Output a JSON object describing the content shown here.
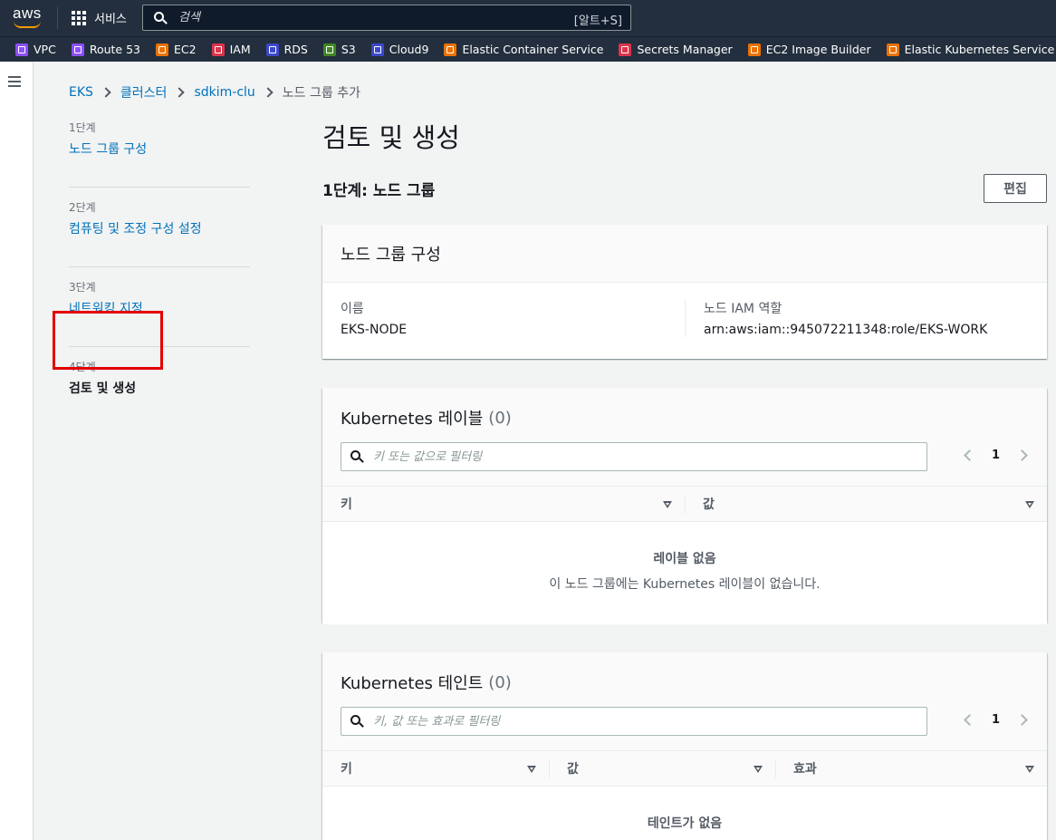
{
  "topnav": {
    "logo_text": "aws",
    "services_label": "서비스",
    "search_placeholder": "검색",
    "search_shortcut": "[알트+S]"
  },
  "favorites": [
    {
      "label": "VPC",
      "color": "#8c4fff"
    },
    {
      "label": "Route 53",
      "color": "#8c4fff"
    },
    {
      "label": "EC2",
      "color": "#ed7100"
    },
    {
      "label": "IAM",
      "color": "#dd344c"
    },
    {
      "label": "RDS",
      "color": "#3b48cc"
    },
    {
      "label": "S3",
      "color": "#3f8624"
    },
    {
      "label": "Cloud9",
      "color": "#3b48cc"
    },
    {
      "label": "Elastic Container Service",
      "color": "#ed7100"
    },
    {
      "label": "Secrets Manager",
      "color": "#dd344c"
    },
    {
      "label": "EC2 Image Builder",
      "color": "#ed7100"
    },
    {
      "label": "Elastic Kubernetes Service",
      "color": "#ed7100"
    }
  ],
  "breadcrumb": {
    "items": [
      "EKS",
      "클러스터",
      "sdkim-clu"
    ],
    "current": "노드 그룹 추가"
  },
  "steps": [
    {
      "num": "1단계",
      "label": "노드 그룹 구성"
    },
    {
      "num": "2단계",
      "label": "컴퓨팅 및 조정 구성 설정"
    },
    {
      "num": "3단계",
      "label": "네트워킹 지정"
    },
    {
      "num": "4단계",
      "label": "검토 및 생성"
    }
  ],
  "page": {
    "title": "검토 및 생성",
    "section_title": "1단계: 노드 그룹",
    "edit_label": "편집"
  },
  "config_card": {
    "title": "노드 그룹 구성",
    "name_key": "이름",
    "name_value": "EKS-NODE",
    "role_key": "노드 IAM 역할",
    "role_value": "arn:aws:iam::945072211348:role/EKS-WORK"
  },
  "labels_card": {
    "title": "Kubernetes 레이블",
    "count": "(0)",
    "filter_placeholder": "키 또는 값으로 필터링",
    "page": "1",
    "col_key": "키",
    "col_value": "값",
    "empty_title": "레이블 없음",
    "empty_desc": "이 노드 그룹에는 Kubernetes 레이블이 없습니다."
  },
  "taints_card": {
    "title": "Kubernetes 테인트",
    "count": "(0)",
    "filter_placeholder": "키, 값 또는 효과로 필터링",
    "page": "1",
    "col_key": "키",
    "col_value": "값",
    "col_effect": "효과",
    "empty_title": "테인트가 없음"
  },
  "colors": {
    "nav_bg": "#232f3e",
    "link": "#0073bb",
    "highlight": "#e30000"
  }
}
